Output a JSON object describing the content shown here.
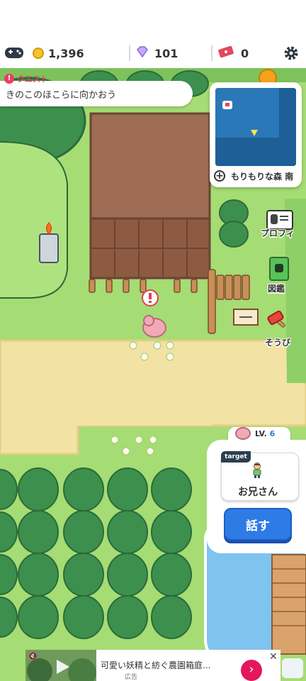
{
  "status_bar": {
    "coins": "1,396",
    "gems": "101",
    "tickets": "0"
  },
  "quest": {
    "label": "クエスト",
    "text": "きのこのほこらに向かおう"
  },
  "minimap": {
    "area_name": "もりもりな森 南"
  },
  "side_menu": {
    "profile": "プロフィ",
    "encyclopedia": "図鑑",
    "equipment": "そうび"
  },
  "player": {
    "level_label": "LV.",
    "level": "6",
    "level_progress": 0.45
  },
  "target": {
    "tag": "target",
    "name": "お兄さん",
    "talk_button": "話す"
  },
  "ad": {
    "title": "可愛い妖精と紡ぐ農園箱庭...",
    "sponsor_label": "広告"
  },
  "colors": {
    "grass": "#a5dc74",
    "path": "#f2e2a4",
    "soil": "#9e6b53",
    "tree": "#3d8f4e",
    "water": "#7fc3ef",
    "talk_button": "#2f7be5",
    "quest_accent": "#ec3d63"
  }
}
